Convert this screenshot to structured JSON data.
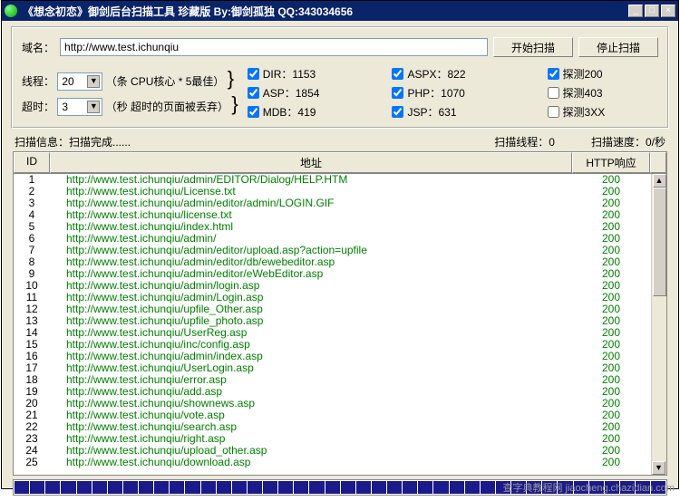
{
  "titlebar": {
    "title": "《想念初恋》御剑后台扫描工具 珍藏版 By:御剑孤独 QQ:343034656"
  },
  "winbtns": {
    "min": "_",
    "max": "□",
    "close": "×"
  },
  "labels": {
    "domain": "域名：",
    "threads": "线程：",
    "threads_hint": "（条 CPU核心 * 5最佳）",
    "timeout": "超时：",
    "timeout_hint": "（秒 超时的页面被丢弃）",
    "scan_info": "扫描信息：扫描完成......",
    "scan_threads": "扫描线程：0",
    "scan_speed": "扫描速度：0/秒"
  },
  "inputs": {
    "url": "http://www.test.ichunqiu",
    "threads": "20",
    "timeout": "3"
  },
  "buttons": {
    "start": "开始扫描",
    "stop": "停止扫描"
  },
  "checks": {
    "dir": "DIR：1153",
    "asp": "ASP：1854",
    "mdb": "MDB：419",
    "aspx": "ASPX：822",
    "php": "PHP：1070",
    "jsp": "JSP：631",
    "p200": "探测200",
    "p403": "探测403",
    "p3xx": "探测3XX"
  },
  "checked": {
    "dir": true,
    "asp": true,
    "mdb": true,
    "aspx": true,
    "php": true,
    "jsp": true,
    "p200": true,
    "p403": false,
    "p3xx": false
  },
  "headers": {
    "id": "ID",
    "url": "地址",
    "resp": "HTTP响应"
  },
  "rows": [
    {
      "id": 1,
      "url": "http://www.test.ichunqiu/admin/EDITOR/Dialog/HELP.HTM",
      "resp": "200"
    },
    {
      "id": 2,
      "url": "http://www.test.ichunqiu/License.txt",
      "resp": "200"
    },
    {
      "id": 3,
      "url": "http://www.test.ichunqiu/admin/editor/admin/LOGIN.GIF",
      "resp": "200"
    },
    {
      "id": 4,
      "url": "http://www.test.ichunqiu/license.txt",
      "resp": "200"
    },
    {
      "id": 5,
      "url": "http://www.test.ichunqiu/index.html",
      "resp": "200"
    },
    {
      "id": 6,
      "url": "http://www.test.ichunqiu/admin/",
      "resp": "200"
    },
    {
      "id": 7,
      "url": "http://www.test.ichunqiu/admin/editor/upload.asp?action=upfile",
      "resp": "200"
    },
    {
      "id": 8,
      "url": "http://www.test.ichunqiu/admin/editor/db/ewebeditor.asp",
      "resp": "200"
    },
    {
      "id": 9,
      "url": "http://www.test.ichunqiu/admin/editor/eWebEditor.asp",
      "resp": "200"
    },
    {
      "id": 10,
      "url": "http://www.test.ichunqiu/admin/login.asp",
      "resp": "200"
    },
    {
      "id": 11,
      "url": "http://www.test.ichunqiu/admin/Login.asp",
      "resp": "200"
    },
    {
      "id": 12,
      "url": "http://www.test.ichunqiu/upfile_Other.asp",
      "resp": "200"
    },
    {
      "id": 13,
      "url": "http://www.test.ichunqiu/upfile_photo.asp",
      "resp": "200"
    },
    {
      "id": 14,
      "url": "http://www.test.ichunqiu/UserReg.asp",
      "resp": "200"
    },
    {
      "id": 15,
      "url": "http://www.test.ichunqiu/inc/config.asp",
      "resp": "200"
    },
    {
      "id": 16,
      "url": "http://www.test.ichunqiu/admin/index.asp",
      "resp": "200"
    },
    {
      "id": 17,
      "url": "http://www.test.ichunqiu/UserLogin.asp",
      "resp": "200"
    },
    {
      "id": 18,
      "url": "http://www.test.ichunqiu/error.asp",
      "resp": "200"
    },
    {
      "id": 19,
      "url": "http://www.test.ichunqiu/add.asp",
      "resp": "200"
    },
    {
      "id": 20,
      "url": "http://www.test.ichunqiu/shownews.asp",
      "resp": "200"
    },
    {
      "id": 21,
      "url": "http://www.test.ichunqiu/vote.asp",
      "resp": "200"
    },
    {
      "id": 22,
      "url": "http://www.test.ichunqiu/search.asp",
      "resp": "200"
    },
    {
      "id": 23,
      "url": "http://www.test.ichunqiu/right.asp",
      "resp": "200"
    },
    {
      "id": 24,
      "url": "http://www.test.ichunqiu/upload_other.asp",
      "resp": "200"
    },
    {
      "id": 25,
      "url": "http://www.test.ichunqiu/download.asp",
      "resp": "200"
    }
  ],
  "watermark": "查字典教程网 jiaocheng.chazidian.com"
}
